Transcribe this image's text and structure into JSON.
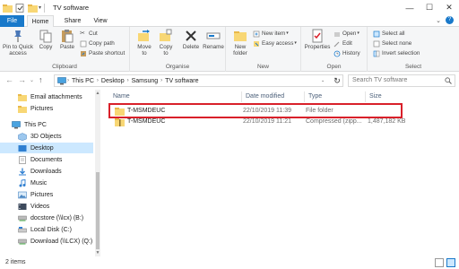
{
  "window": {
    "title": "TV software",
    "controls": {
      "minimize": "—",
      "maximize": "☐",
      "close": "✕"
    }
  },
  "tabs": [
    {
      "label": "File"
    },
    {
      "label": "Home"
    },
    {
      "label": "Share"
    },
    {
      "label": "View"
    }
  ],
  "ribbon": {
    "clipboard": {
      "label": "Clipboard",
      "pin": "Pin to Quick access",
      "copy": "Copy",
      "paste": "Paste",
      "cut": "Cut",
      "copy_path": "Copy path",
      "paste_shortcut": "Paste shortcut"
    },
    "organise": {
      "label": "Organise",
      "move_to": "Move to",
      "copy_to": "Copy to",
      "delete": "Delete",
      "rename": "Rename"
    },
    "new": {
      "label": "New",
      "new_folder": "New folder",
      "new_item": "New item",
      "easy_access": "Easy access"
    },
    "open": {
      "label": "Open",
      "properties": "Properties",
      "open": "Open",
      "edit": "Edit",
      "history": "History"
    },
    "select": {
      "label": "Select",
      "select_all": "Select all",
      "select_none": "Select none",
      "invert_selection": "Invert selection"
    }
  },
  "address": {
    "crumbs": [
      "This PC",
      "Desktop",
      "Samsung",
      "TV software"
    ],
    "search_placeholder": "Search TV software"
  },
  "nav": {
    "items": [
      {
        "label": "Email attachments",
        "icon": "folder-icon"
      },
      {
        "label": "Pictures",
        "icon": "folder-icon"
      },
      {
        "label": "This PC",
        "icon": "pc-icon"
      },
      {
        "label": "3D Objects",
        "icon": "3d-objects-icon"
      },
      {
        "label": "Desktop",
        "icon": "desktop-icon",
        "selected": true
      },
      {
        "label": "Documents",
        "icon": "documents-icon"
      },
      {
        "label": "Downloads",
        "icon": "downloads-icon"
      },
      {
        "label": "Music",
        "icon": "music-icon"
      },
      {
        "label": "Pictures",
        "icon": "pictures-icon"
      },
      {
        "label": "Videos",
        "icon": "videos-icon"
      },
      {
        "label": "docstore (\\\\lcx) (B:)",
        "icon": "network-drive-icon"
      },
      {
        "label": "Local Disk (C:)",
        "icon": "local-disk-icon"
      },
      {
        "label": "Download (\\\\LCX) (Q:)",
        "icon": "network-drive-icon"
      }
    ]
  },
  "table": {
    "columns": [
      "Name",
      "Date modified",
      "Type",
      "Size"
    ],
    "rows": [
      {
        "name": "T-MSMDEUC",
        "date": "22/10/2019 11:39",
        "type": "File folder",
        "size": "",
        "icon": "folder-icon"
      },
      {
        "name": "T-MSMDEUC",
        "date": "22/10/2019 11:21",
        "type": "Compressed (zipp...",
        "size": "1,487,182 KB",
        "icon": "zip-folder-icon"
      }
    ]
  },
  "status": {
    "count": "2 items"
  },
  "colors": {
    "accent": "#1979ca",
    "selection": "#cce8ff",
    "highlight_box": "#d9202a",
    "folder": "#f8d775"
  }
}
